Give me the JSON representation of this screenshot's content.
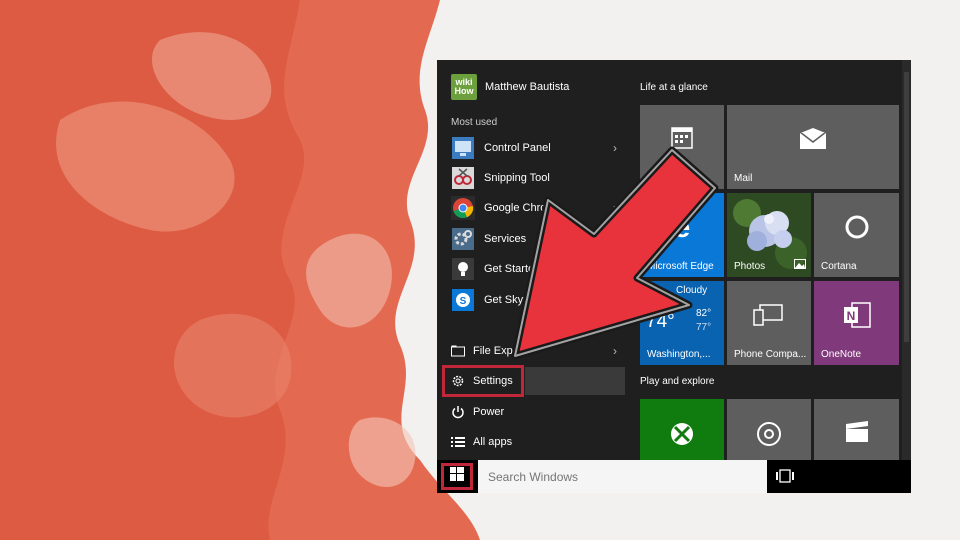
{
  "user": {
    "name": "Matthew Bautista",
    "avatar_text": "wiki\nHow"
  },
  "most_used_label": "Most used",
  "apps": [
    {
      "label": "Control Panel",
      "icon": "control-panel-icon",
      "has_submenu": true
    },
    {
      "label": "Snipping Tool",
      "icon": "snipping-tool-icon",
      "has_submenu": false
    },
    {
      "label": "Google Chrome",
      "icon": "chrome-icon",
      "has_submenu": true
    },
    {
      "label": "Services",
      "icon": "services-icon",
      "has_submenu": false
    },
    {
      "label": "Get Started",
      "icon": "lightbulb-icon",
      "has_submenu": false
    },
    {
      "label": "Get Skype",
      "icon": "skype-icon",
      "has_submenu": false
    }
  ],
  "bottom": {
    "file_explorer": "File Explorer",
    "settings": "Settings",
    "power": "Power",
    "all_apps": "All apps"
  },
  "groups": {
    "life": "Life at a glance",
    "play": "Play and explore"
  },
  "tiles": {
    "mail": "Mail",
    "edge": "Microsoft Edge",
    "photos": "Photos",
    "cortana": "Cortana",
    "weather_cond": "Cloudy",
    "weather_temp": "74°",
    "weather_hi": "82°",
    "weather_lo": "77°",
    "weather_city": "Washington,...",
    "phone": "Phone Compa...",
    "onenote": "OneNote"
  },
  "search": {
    "placeholder": "Search Windows"
  },
  "colors": {
    "highlight": "#c0283a",
    "edge_tile": "#0a78d7",
    "onenote_tile": "#80397b",
    "xbox_tile": "#107c10",
    "gray_tile": "#5e5e5e"
  }
}
